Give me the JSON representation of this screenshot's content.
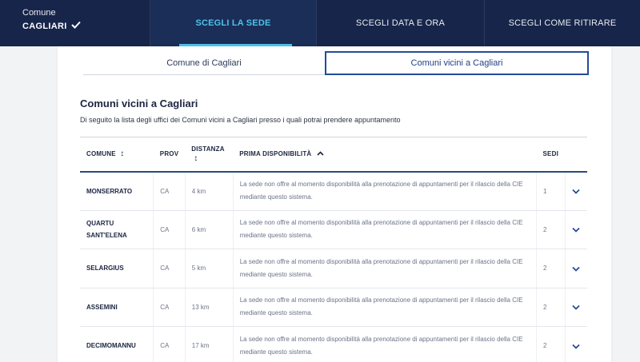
{
  "header": {
    "comune_label": "Comune",
    "comune_value": "CAGLIARI",
    "steps": [
      "SCEGLI LA SEDE",
      "SCEGLI DATA E ORA",
      "SCEGLI COME RITIRARE"
    ]
  },
  "tabs": [
    "Comune di Cagliari",
    "Comuni vicini a Cagliari"
  ],
  "section": {
    "title": "Comuni vicini a Cagliari",
    "description": "Di seguito la lista degli uffici dei Comuni vicini a Cagliari presso i quali potrai prendere appuntamento"
  },
  "table": {
    "headers": {
      "comune": "COMUNE",
      "prov": "PROV",
      "distanza": "DISTANZA",
      "prima": "PRIMA DISPONIBILITÀ",
      "sedi": "SEDI"
    },
    "rows": [
      {
        "comune": "MONSERRATO",
        "prov": "CA",
        "distanza": "4 km",
        "prima": "La sede non offre al momento disponibilità alla prenotazione di appuntamenti per il rilascio della CIE mediante questo sistema.",
        "sedi": "1"
      },
      {
        "comune": "QUARTU SANT'ELENA",
        "prov": "CA",
        "distanza": "6 km",
        "prima": "La sede non offre al momento disponibilità alla prenotazione di appuntamenti per il rilascio della CIE mediante questo sistema.",
        "sedi": "2"
      },
      {
        "comune": "SELARGIUS",
        "prov": "CA",
        "distanza": "5 km",
        "prima": "La sede non offre al momento disponibilità alla prenotazione di appuntamenti per il rilascio della CIE mediante questo sistema.",
        "sedi": "2"
      },
      {
        "comune": "ASSEMINI",
        "prov": "CA",
        "distanza": "13 km",
        "prima": "La sede non offre al momento disponibilità alla prenotazione di appuntamenti per il rilascio della CIE mediante questo sistema.",
        "sedi": "2"
      },
      {
        "comune": "DECIMOMANNU",
        "prov": "CA",
        "distanza": "17 km",
        "prima": "La sede non offre al momento disponibilità alla prenotazione di appuntamenti per il rilascio della CIE mediante questo sistema.",
        "sedi": "2"
      }
    ]
  },
  "icons": {
    "check": "check-icon",
    "sort": "sort-icon",
    "chevron_up": "chevron-up-icon",
    "chevron_down": "chevron-down-icon"
  },
  "colors": {
    "header_bg": "#17254a",
    "active_step": "#4ec3e8",
    "accent": "#244b9a"
  }
}
